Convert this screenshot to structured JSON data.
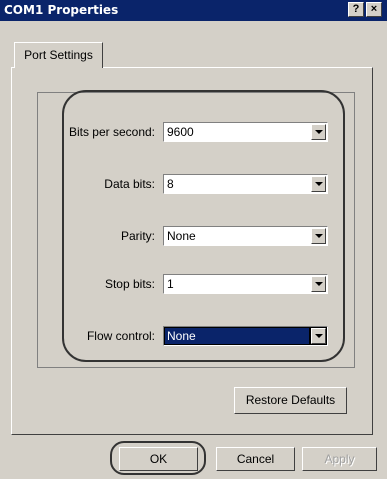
{
  "window": {
    "title": "COM1 Properties",
    "help_label": "?",
    "close_label": "×"
  },
  "tabs": [
    {
      "label": "Port Settings"
    }
  ],
  "fields": {
    "bits_per_second": {
      "label": "Bits per second:",
      "value": "9600"
    },
    "data_bits": {
      "label": "Data bits:",
      "value": "8"
    },
    "parity": {
      "label": "Parity:",
      "value": "None"
    },
    "stop_bits": {
      "label": "Stop bits:",
      "value": "1"
    },
    "flow_control": {
      "label": "Flow control:",
      "value": "None"
    }
  },
  "buttons": {
    "restore_defaults": "Restore Defaults",
    "ok": "OK",
    "cancel": "Cancel",
    "apply": "Apply"
  },
  "colors": {
    "titlebar": "#0a246a",
    "face": "#d4d0c8",
    "highlight_ring": "#333333"
  }
}
